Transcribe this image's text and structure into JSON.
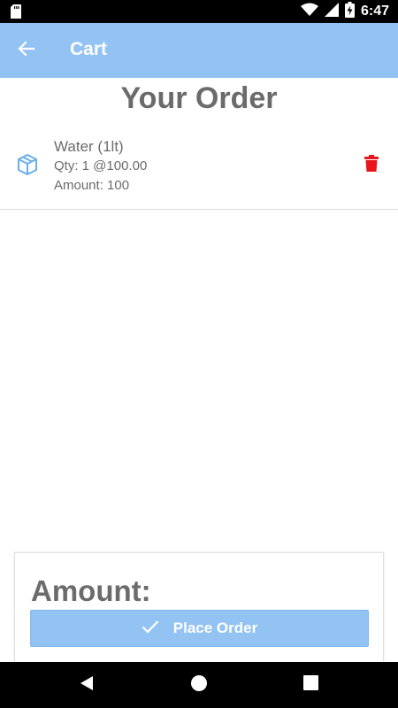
{
  "status_bar": {
    "time": "6:47",
    "icons": [
      "sd-card-icon",
      "wifi-icon",
      "signal-icon",
      "battery-charging-icon"
    ]
  },
  "app_bar": {
    "title": "Cart",
    "back_icon": "arrow-left-icon",
    "color": "#93c3f2"
  },
  "page": {
    "heading": "Your Order"
  },
  "cart": {
    "items": [
      {
        "name": "Water (1lt)",
        "qty_line": "Qty: 1 @100.00",
        "amount_line": "Amount: 100",
        "icon": "cube-icon",
        "delete_icon": "trash-icon",
        "delete_color": "#e8151b"
      }
    ]
  },
  "summary": {
    "amount_label": "Amount:",
    "place_order_label": "Place Order",
    "place_order_icon": "check-icon"
  },
  "nav_bar": {
    "icons": [
      "back-triangle-icon",
      "home-circle-icon",
      "recents-square-icon"
    ]
  }
}
